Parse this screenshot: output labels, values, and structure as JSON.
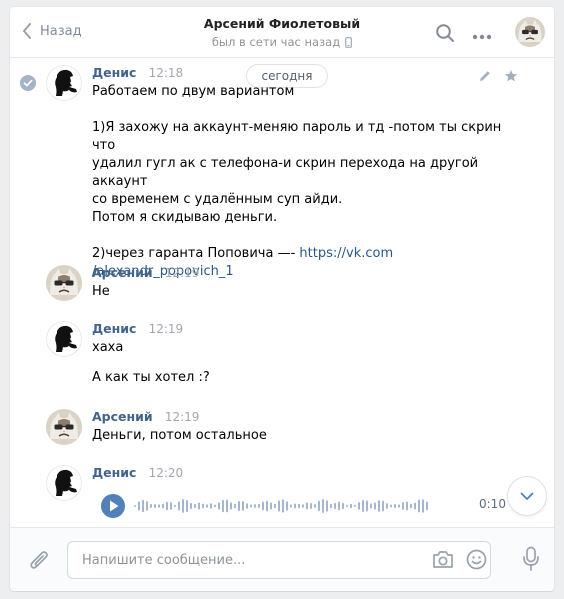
{
  "header": {
    "back_label": "Назад",
    "peer_name": "Арсений Фиолетовый",
    "peer_status": "был в сети час назад",
    "icons": [
      "chevron-left-icon",
      "mobile-icon",
      "search-icon",
      "more-icon"
    ]
  },
  "history": {
    "date_label": "сегодня"
  },
  "messages": [
    {
      "author": "Денис",
      "time": "12:18",
      "text": "Работаем по двум вариантом\n\n1)Я захожу на аккаунт-меняю пароль и тд -потом ты скрин что\nудалил гугл ак с телефона-и скрин перехода на другой аккаунт\nсо временем с удалённым суп айди.\nПотом я скидываю деньги.\n\n2)через гаранта Поповича —- ",
      "link_line1": "https://vk.com",
      "link_line2": "/alexandr_popovich_1"
    },
    {
      "author": "Арсений",
      "time": "12:19",
      "text": "Не"
    },
    {
      "author": "Денис",
      "time": "12:19",
      "text": "хаха",
      "extra": "А как ты хотел :?"
    },
    {
      "author": "Арсений",
      "time": "12:19",
      "text": "Деньги, потом остальное"
    },
    {
      "author": "Денис",
      "time": "12:20",
      "audio_duration": "0:10"
    }
  ],
  "composer": {
    "placeholder": "Напишите сообщение...",
    "value": ""
  },
  "colors": {
    "accent": "#5181b8",
    "name": "#42648b",
    "link": "#2a5885",
    "background": "#edeef0"
  }
}
